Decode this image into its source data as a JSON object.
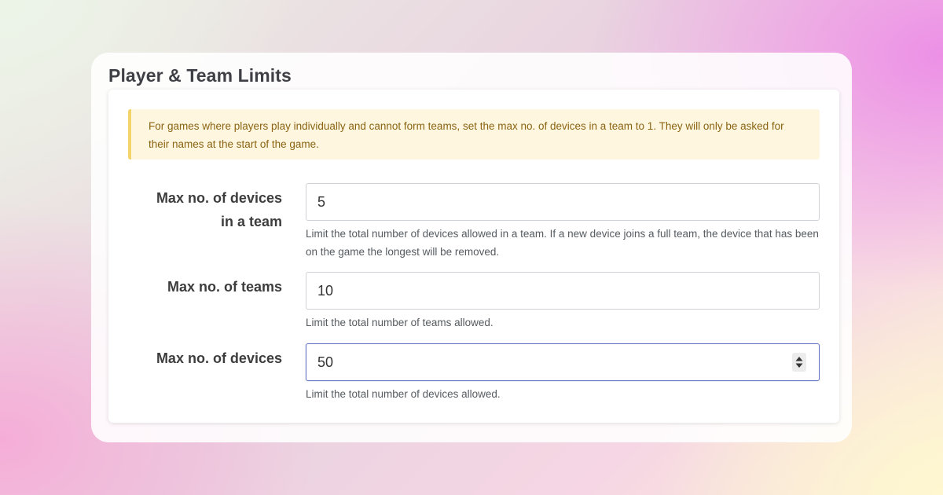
{
  "section": {
    "title": "Player & Team Limits"
  },
  "alert": {
    "text": "For games where players play individually and cannot form teams, set the max no. of devices in a team to 1. They will only be asked for their names at the start of the game."
  },
  "fields": {
    "team_devices": {
      "label_line1": "Max no. of devices",
      "label_line2": "in a team",
      "value": "5",
      "help": "Limit the total number of devices allowed in a team. If a new device joins a full team, the device that has been on the game the longest will be removed."
    },
    "teams": {
      "label": "Max no. of teams",
      "value": "10",
      "help": "Limit the total number of teams allowed."
    },
    "devices": {
      "label": "Max no. of devices",
      "value": "50",
      "help": "Limit the total number of devices allowed."
    }
  },
  "icons": {
    "spinner": "up-down-spinner-icon"
  },
  "colors": {
    "alert_background": "#fff6e0",
    "alert_border": "#f5d36b",
    "alert_text": "#8a6412",
    "focus_border": "#6574c4"
  }
}
